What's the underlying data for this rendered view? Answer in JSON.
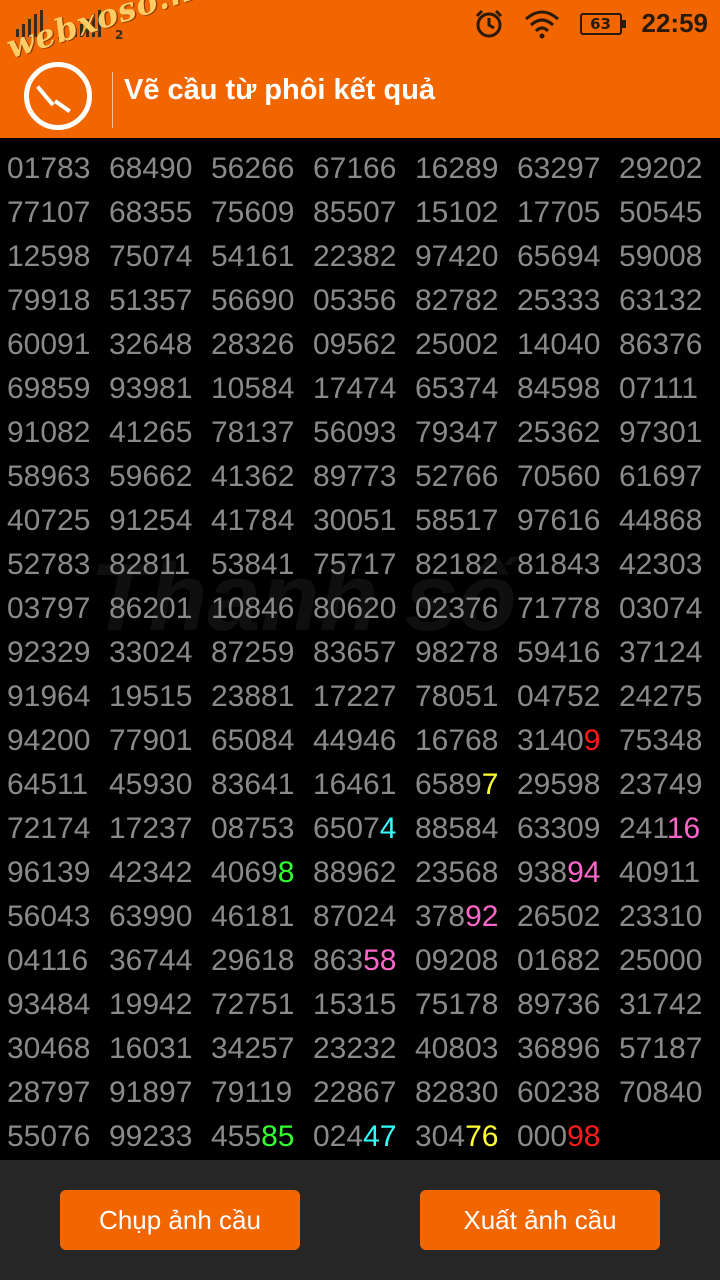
{
  "status_bar": {
    "sim1_label": "1",
    "sim2_label": "2",
    "battery": "63",
    "time": "22:59",
    "alarm_icon": "alarm-clock-icon",
    "wifi_icon": "wifi-icon"
  },
  "app_bar": {
    "watermark": "webxoso.net",
    "title": "Vẽ cầu từ phôi kết quả"
  },
  "background_watermark": "Thanh số",
  "colors": {
    "accent": "#f26600",
    "red": "#ff1a1a",
    "yellow": "#ffff33",
    "cyan": "#33ffff",
    "pink": "#ff66cc",
    "green": "#33ff33"
  },
  "grid": {
    "rows": [
      [
        [
          "01783"
        ],
        [
          "68490"
        ],
        [
          "56266"
        ],
        [
          "67166"
        ],
        [
          "16289"
        ],
        [
          "63297"
        ],
        [
          "29202"
        ]
      ],
      [
        [
          "77107"
        ],
        [
          "68355"
        ],
        [
          "75609"
        ],
        [
          "85507"
        ],
        [
          "15102"
        ],
        [
          "17705"
        ],
        [
          "50545"
        ]
      ],
      [
        [
          "12598"
        ],
        [
          "75074"
        ],
        [
          "54161"
        ],
        [
          "22382"
        ],
        [
          "97420"
        ],
        [
          "65694"
        ],
        [
          "59008"
        ]
      ],
      [
        [
          "79918"
        ],
        [
          "51357"
        ],
        [
          "56690"
        ],
        [
          "05356"
        ],
        [
          "82782"
        ],
        [
          "25333"
        ],
        [
          "63132"
        ]
      ],
      [
        [
          "60091"
        ],
        [
          "32648"
        ],
        [
          "28326"
        ],
        [
          "09562"
        ],
        [
          "25002"
        ],
        [
          "14040"
        ],
        [
          "86376"
        ]
      ],
      [
        [
          "69859"
        ],
        [
          "93981"
        ],
        [
          "10584"
        ],
        [
          "17474"
        ],
        [
          "65374"
        ],
        [
          "84598"
        ],
        [
          "07111"
        ]
      ],
      [
        [
          "91082"
        ],
        [
          "41265"
        ],
        [
          "78137"
        ],
        [
          "56093"
        ],
        [
          "79347"
        ],
        [
          "25362"
        ],
        [
          "97301"
        ]
      ],
      [
        [
          "58963"
        ],
        [
          "59662"
        ],
        [
          "41362"
        ],
        [
          "89773"
        ],
        [
          "52766"
        ],
        [
          "70560"
        ],
        [
          "61697"
        ]
      ],
      [
        [
          "40725"
        ],
        [
          "91254"
        ],
        [
          "41784"
        ],
        [
          "30051"
        ],
        [
          "58517"
        ],
        [
          "97616"
        ],
        [
          "44868"
        ]
      ],
      [
        [
          "52783"
        ],
        [
          "82811"
        ],
        [
          "53841"
        ],
        [
          "75717"
        ],
        [
          "82182"
        ],
        [
          "81843"
        ],
        [
          "42303"
        ]
      ],
      [
        [
          "03797"
        ],
        [
          "86201"
        ],
        [
          "10846"
        ],
        [
          "80620"
        ],
        [
          "02376"
        ],
        [
          "71778"
        ],
        [
          "03074"
        ]
      ],
      [
        [
          "92329"
        ],
        [
          "33024"
        ],
        [
          "87259"
        ],
        [
          "83657"
        ],
        [
          "98278"
        ],
        [
          "59416"
        ],
        [
          "37124"
        ]
      ],
      [
        [
          "91964"
        ],
        [
          "19515"
        ],
        [
          "23881"
        ],
        [
          "17227"
        ],
        [
          "78051"
        ],
        [
          "04752"
        ],
        [
          "24275"
        ]
      ],
      [
        [
          "94200"
        ],
        [
          "77901"
        ],
        [
          "65084"
        ],
        [
          "44946"
        ],
        [
          "16768"
        ],
        [
          "3140",
          "9",
          "red"
        ],
        [
          "75348"
        ]
      ],
      [
        [
          "64511"
        ],
        [
          "45930"
        ],
        [
          "83641"
        ],
        [
          "16461"
        ],
        [
          "6589",
          "7",
          "yellow"
        ],
        [
          "29598"
        ],
        [
          "23749"
        ]
      ],
      [
        [
          "72174"
        ],
        [
          "17237"
        ],
        [
          "08753"
        ],
        [
          "6507",
          "4",
          "cyan"
        ],
        [
          "88584"
        ],
        [
          "63309"
        ],
        [
          "241",
          "16",
          "pink"
        ]
      ],
      [
        [
          "96139"
        ],
        [
          "42342"
        ],
        [
          "4069",
          "8",
          "green"
        ],
        [
          "88962"
        ],
        [
          "23568"
        ],
        [
          "938",
          "94",
          "pink"
        ],
        [
          "40911"
        ]
      ],
      [
        [
          "56043"
        ],
        [
          "63990"
        ],
        [
          "46181"
        ],
        [
          "87024"
        ],
        [
          "378",
          "92",
          "pink"
        ],
        [
          "26502"
        ],
        [
          "23310"
        ]
      ],
      [
        [
          "04116"
        ],
        [
          "36744"
        ],
        [
          "29618"
        ],
        [
          "863",
          "58",
          "pink"
        ],
        [
          "09208"
        ],
        [
          "01682"
        ],
        [
          "25000"
        ]
      ],
      [
        [
          "93484"
        ],
        [
          "19942"
        ],
        [
          "72751"
        ],
        [
          "15315"
        ],
        [
          "75178"
        ],
        [
          "89736"
        ],
        [
          "31742"
        ]
      ],
      [
        [
          "30468"
        ],
        [
          "16031"
        ],
        [
          "34257"
        ],
        [
          "23232"
        ],
        [
          "40803"
        ],
        [
          "36896"
        ],
        [
          "57187"
        ]
      ],
      [
        [
          "28797"
        ],
        [
          "91897"
        ],
        [
          "79119"
        ],
        [
          "22867"
        ],
        [
          "82830"
        ],
        [
          "60238"
        ],
        [
          "70840"
        ]
      ],
      [
        [
          "55076"
        ],
        [
          "99233"
        ],
        [
          "455",
          "85",
          "green"
        ],
        [
          "024",
          "47",
          "cyan"
        ],
        [
          "304",
          "76",
          "yellow"
        ],
        [
          "000",
          "98",
          "red"
        ]
      ]
    ]
  },
  "buttons": {
    "capture": "Chụp ảnh cầu",
    "export": "Xuất ảnh cầu"
  }
}
